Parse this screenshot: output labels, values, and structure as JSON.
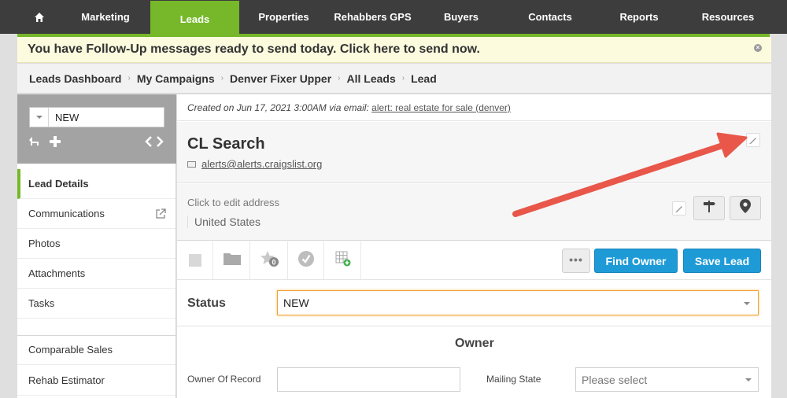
{
  "nav": {
    "items": [
      {
        "label": ""
      },
      {
        "label": "Marketing"
      },
      {
        "label": "Leads"
      },
      {
        "label": "Properties"
      },
      {
        "label": "Rehabbers GPS"
      },
      {
        "label": "Buyers"
      },
      {
        "label": "Contacts"
      },
      {
        "label": "Reports"
      },
      {
        "label": "Resources"
      }
    ],
    "active_color": "#76b82a"
  },
  "banner": {
    "text": "You have Follow-Up messages ready to send today. Click here to send now."
  },
  "breadcrumb": [
    "Leads Dashboard",
    "My Campaigns",
    "Denver Fixer Upper",
    "All Leads",
    "Lead"
  ],
  "sidebar": {
    "status_value": "NEW",
    "items": [
      {
        "label": "Lead Details"
      },
      {
        "label": "Communications"
      },
      {
        "label": "Photos"
      },
      {
        "label": "Attachments"
      },
      {
        "label": "Tasks"
      },
      {
        "label": "Comparable Sales"
      },
      {
        "label": "Rehab Estimator"
      }
    ]
  },
  "lead": {
    "created_prefix": "Created on Jun 17, 2021 3:00AM via email:",
    "created_link": "alert: real estate for sale (denver)",
    "title": "CL Search",
    "email": "alerts@alerts.craigslist.org",
    "address_prompt": "Click to edit address",
    "country": "United States"
  },
  "toolbar": {
    "more_label": "•••",
    "find_owner_label": "Find Owner",
    "save_lead_label": "Save Lead",
    "button_color": "#1e9bd7"
  },
  "status": {
    "label": "Status",
    "value": "NEW"
  },
  "owner": {
    "title": "Owner",
    "owner_of_record_label": "Owner Of Record",
    "owner_of_record_value": "",
    "mailing_state_label": "Mailing State",
    "mailing_state_placeholder": "Please select"
  },
  "annotation": {
    "arrow_color": "#e8574a"
  }
}
